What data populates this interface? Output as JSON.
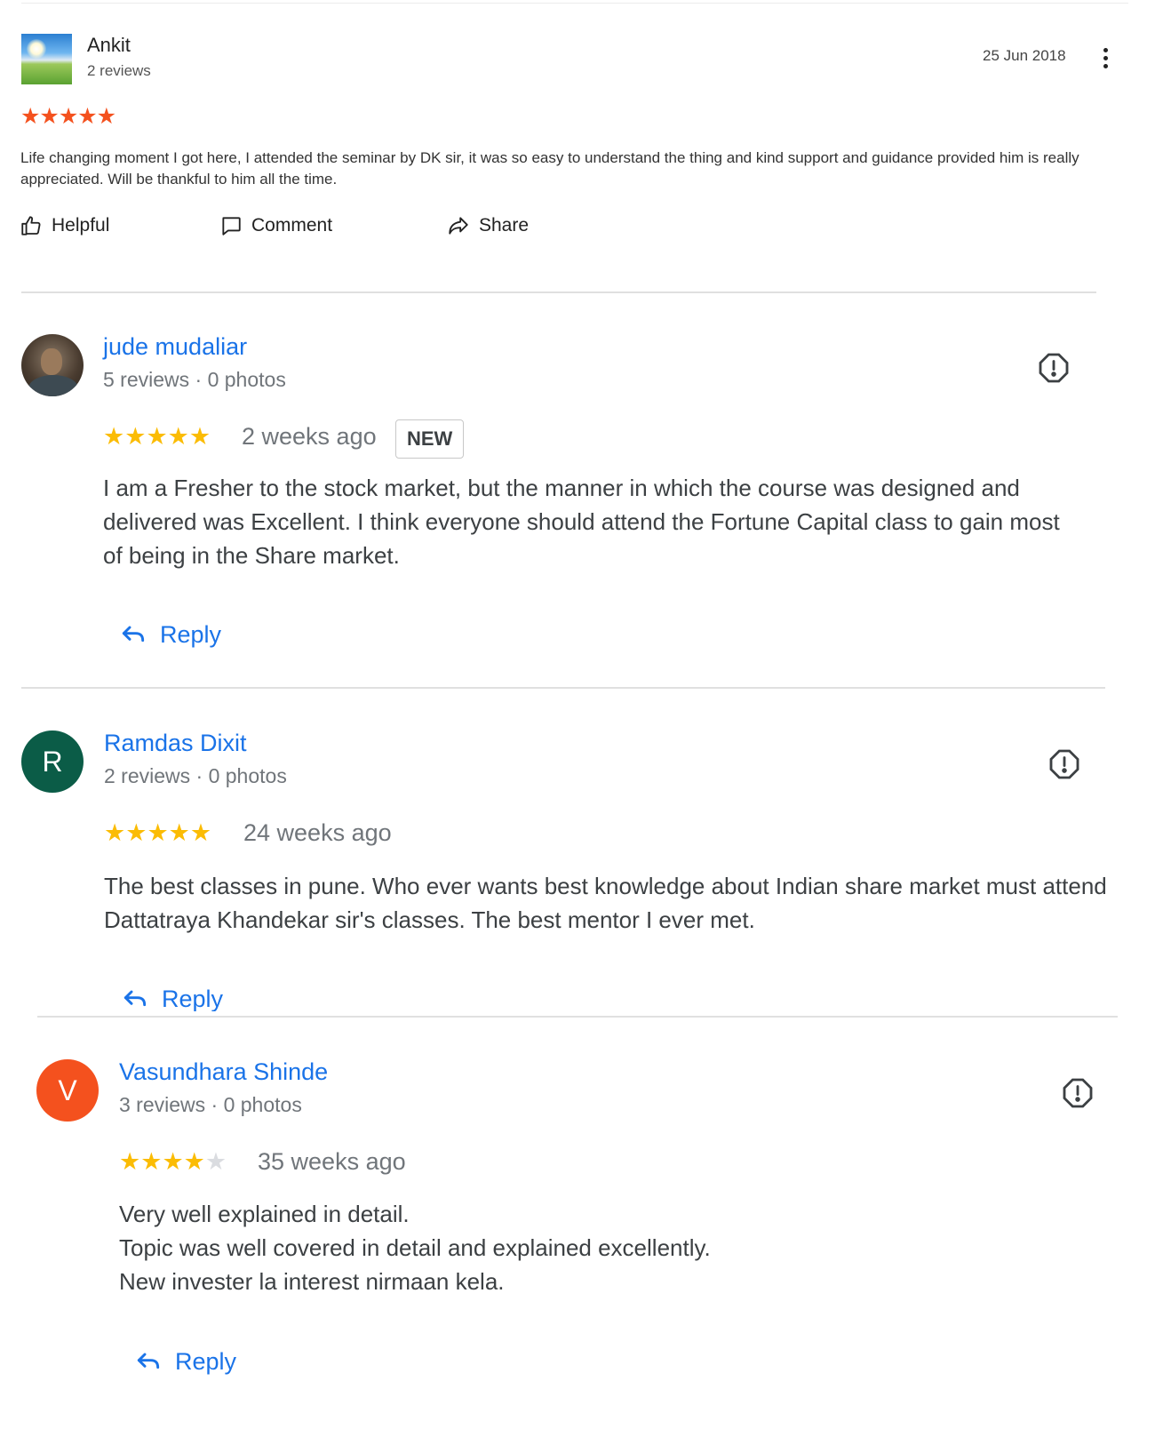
{
  "reviews": [
    {
      "name": "Ankit",
      "meta": "2 reviews",
      "date": "25 Jun 2018",
      "stars": "★★★★★",
      "text": "Life changing moment I got here, I attended the seminar by DK sir, it was so easy to understand the thing and kind support and guidance provided him is really appreciated. Will be thankful to him all the time.",
      "actions": {
        "helpful": "Helpful",
        "comment": "Comment",
        "share": "Share"
      }
    },
    {
      "name": "jude mudaliar",
      "meta": "5 reviews · 0 photos",
      "rating": 5,
      "time": "2 weeks ago",
      "badge": "NEW",
      "text": "I am a Fresher to the stock market, but the manner in which the course was designed and delivered was Excellent. I think everyone should attend the Fortune Capital class to gain most of being in the Share market.",
      "reply": "Reply"
    },
    {
      "name": "Ramdas Dixit",
      "initial": "R",
      "avatar_color": "#0b5c47",
      "meta": "2 reviews · 0 photos",
      "rating": 5,
      "time": "24 weeks ago",
      "text": "The best classes in pune. Who ever wants best knowledge about Indian share market must attend Dattatraya Khandekar sir's classes. The best mentor I ever met.",
      "reply": "Reply"
    },
    {
      "name": "Vasundhara Shinde",
      "initial": "V",
      "avatar_color": "#f4511e",
      "meta": "3 reviews · 0 photos",
      "rating": 4,
      "time": "35 weeks ago",
      "text_lines": [
        "Very well explained in detail.",
        "Topic was well covered in detail and explained excellently.",
        "New invester la interest nirmaan kela."
      ],
      "reply": "Reply"
    }
  ],
  "colors": {
    "link": "#1a73e8",
    "star": "#fbbc04",
    "star_orange": "#f4511e"
  },
  "icons": [
    "thumbs-up-icon",
    "comment-icon",
    "share-icon",
    "more-vert-icon",
    "report-icon",
    "reply-icon"
  ]
}
